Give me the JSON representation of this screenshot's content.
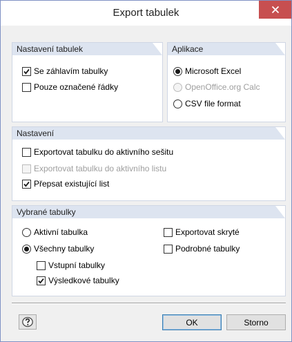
{
  "window": {
    "title": "Export tabulek"
  },
  "groups": {
    "table_settings": {
      "title": "Nastavení tabulek",
      "items": [
        {
          "label": "Se záhlavím tabulky",
          "checked": true,
          "disabled": false
        },
        {
          "label": "Pouze označené řádky",
          "checked": false,
          "disabled": false
        }
      ]
    },
    "application": {
      "title": "Aplikace",
      "items": [
        {
          "label": "Microsoft Excel",
          "selected": true,
          "disabled": false
        },
        {
          "label": "OpenOffice.org Calc",
          "selected": false,
          "disabled": true
        },
        {
          "label": "CSV file format",
          "selected": false,
          "disabled": false
        }
      ]
    },
    "settings": {
      "title": "Nastavení",
      "items": [
        {
          "label": "Exportovat tabulku do aktivního sešitu",
          "checked": false,
          "disabled": false
        },
        {
          "label": "Exportovat tabulku do aktivního listu",
          "checked": false,
          "disabled": true
        },
        {
          "label": "Přepsat existující list",
          "checked": true,
          "disabled": false
        }
      ]
    },
    "selected_tables": {
      "title": "Vybrané tabulky",
      "radios": [
        {
          "label": "Aktivní tabulka",
          "selected": false
        },
        {
          "label": "Všechny tabulky",
          "selected": true
        }
      ],
      "sub_checks": [
        {
          "label": "Vstupní tabulky",
          "checked": false
        },
        {
          "label": "Výsledkové tabulky",
          "checked": true
        }
      ],
      "right_checks": [
        {
          "label": "Exportovat skryté",
          "checked": false
        },
        {
          "label": "Podrobné tabulky",
          "checked": false
        }
      ]
    }
  },
  "buttons": {
    "ok": "OK",
    "cancel": "Storno"
  },
  "icons": {
    "close": "close-icon",
    "help": "help-icon"
  },
  "colors": {
    "close_bg": "#c74f50",
    "group_header": "#dde4f0",
    "accent_border": "#3c7fb1"
  }
}
